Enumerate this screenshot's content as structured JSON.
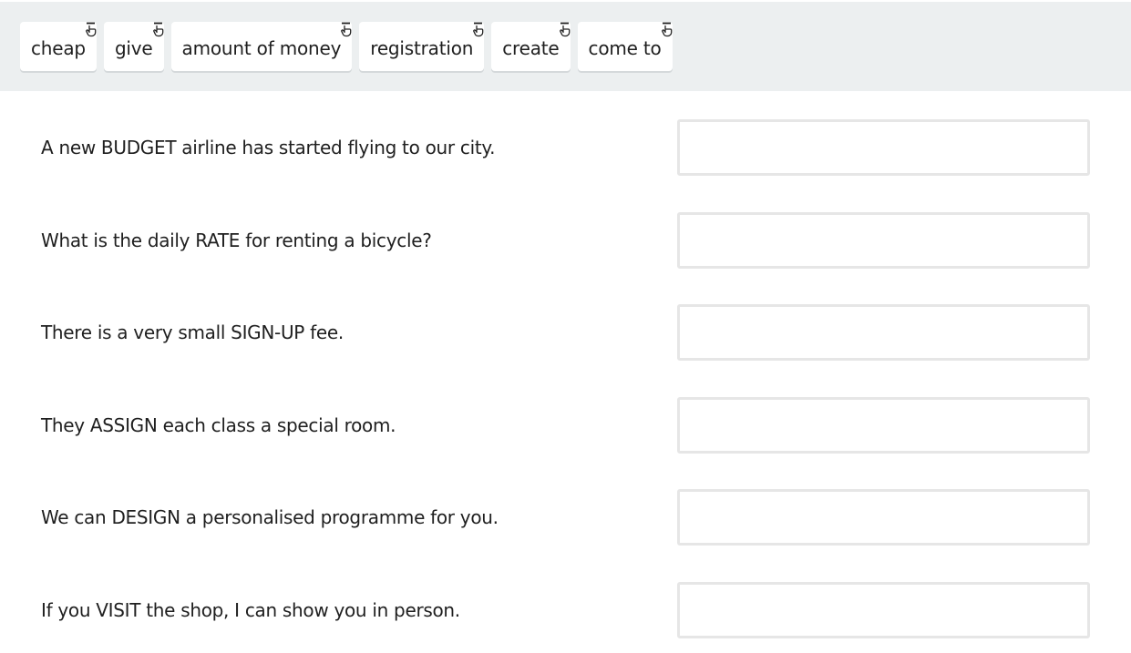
{
  "word_bank": {
    "chips": [
      {
        "label": "cheap",
        "icon": "drag-hand-icon"
      },
      {
        "label": "give",
        "icon": "drag-hand-icon"
      },
      {
        "label": "amount of money",
        "icon": "drag-hand-icon"
      },
      {
        "label": "registration",
        "icon": "drag-hand-icon"
      },
      {
        "label": "create",
        "icon": "drag-hand-icon"
      },
      {
        "label": "come to",
        "icon": "drag-hand-icon"
      }
    ]
  },
  "questions": [
    {
      "sentence": "A new BUDGET airline has started flying to our city.",
      "answer": ""
    },
    {
      "sentence": "What is the daily RATE for renting a bicycle?",
      "answer": ""
    },
    {
      "sentence": "There is a very small SIGN-UP fee.",
      "answer": ""
    },
    {
      "sentence": "They ASSIGN each class a special room.",
      "answer": ""
    },
    {
      "sentence": "We can DESIGN a personalised programme for you.",
      "answer": ""
    },
    {
      "sentence": "If you VISIT the shop, I can show you in person.",
      "answer": ""
    }
  ],
  "colors": {
    "word_bank_background": "#eceff0",
    "chip_background": "#ffffff",
    "dropzone_border": "#e6e6e6",
    "text": "#1f1f1f"
  }
}
